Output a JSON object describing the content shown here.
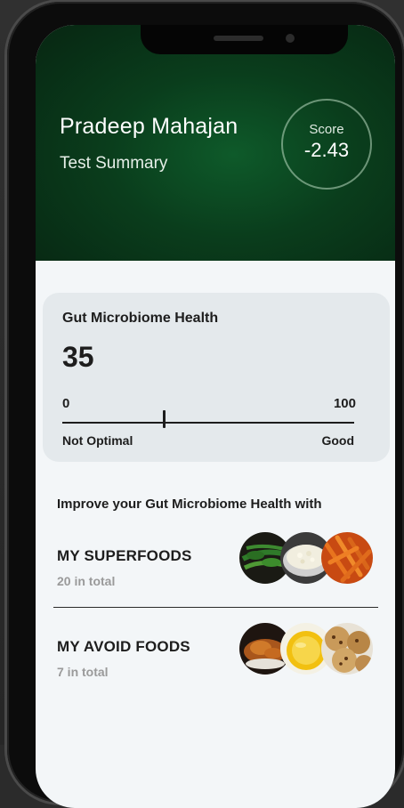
{
  "profile": {
    "name": "Pradeep Mahajan",
    "subtitle": "Test Summary"
  },
  "score": {
    "label": "Score",
    "value": "-2.43"
  },
  "gut_health": {
    "title": "Gut Microbiome Health",
    "value": "35",
    "min_label": "0",
    "max_label": "100",
    "low_label": "Not Optimal",
    "high_label": "Good",
    "level_fraction": 0.35
  },
  "improve_heading": "Improve your Gut Microbiome Health with",
  "food_sections": [
    {
      "title": "MY SUPERFOODS",
      "count": "20 in total",
      "images": [
        "leafy-greens-icon",
        "white-grain-icon",
        "carrot-sticks-icon"
      ]
    },
    {
      "title": "MY AVOID FOODS",
      "count": "7 in total",
      "images": [
        "roast-chicken-icon",
        "yellow-oil-icon",
        "cookies-icon"
      ]
    }
  ],
  "colors": {
    "header_green": "#0a3d1c",
    "card_bg": "#e4e9ec",
    "screen_bg": "#f3f6f8"
  }
}
